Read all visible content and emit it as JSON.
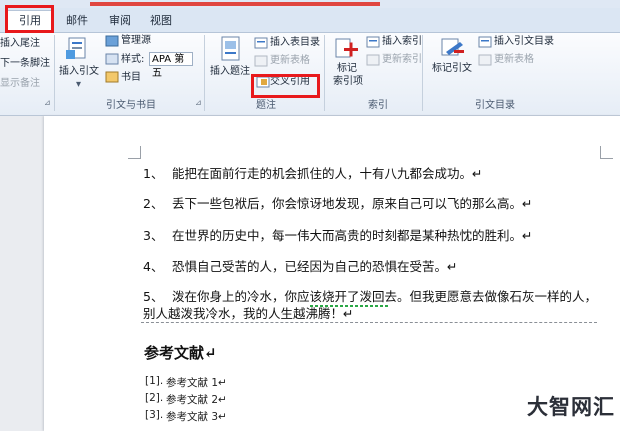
{
  "tabs": [
    {
      "label": "引用",
      "active": true
    },
    {
      "label": "邮件"
    },
    {
      "label": "审阅"
    },
    {
      "label": "视图"
    }
  ],
  "ribbon": {
    "footnote": {
      "insert_endnote": "插入尾注",
      "next_footnote": "下一条脚注",
      "show_notes": "显示备注"
    },
    "citations": {
      "insert_citation": "插入引文",
      "manage_sources": "管理源",
      "style_label": "样式:",
      "style_value": "APA 第五",
      "bibliography": "书目",
      "group_label": "引文与书目"
    },
    "captions": {
      "insert_caption": "插入题注",
      "insert_table_of_figures": "插入表目录",
      "update_table": "更新表格",
      "cross_reference": "交叉引用",
      "group_label": "题注"
    },
    "index": {
      "mark_entry_line1": "标记",
      "mark_entry_line2": "索引项",
      "insert_index": "插入索引",
      "update_index": "更新索引",
      "group_label": "索引"
    },
    "toa": {
      "mark_citation": "标记引文",
      "insert_toa": "插入引文目录",
      "update_table": "更新表格",
      "group_label": "引文目录"
    }
  },
  "document": {
    "paragraphs": [
      {
        "num": "1、",
        "text": "能把在面前行走的机会抓住的人，十有八九都会成功。↵"
      },
      {
        "num": "2、",
        "text": "丢下一些包袱后，你会惊讶地发现，原来自己可以飞的那么高。↵"
      },
      {
        "num": "3、",
        "text": "在世界的历史中，每一伟大而高贵的时刻都是某种热忱的胜利。↵"
      },
      {
        "num": "4、",
        "text": "恐惧自己受苦的人，已经因为自己的恐惧在受苦。↵"
      },
      {
        "num": "5、",
        "text": "泼在你身上的冷水，你应该烧开了泼回去。但我更愿意去做像石灰一样的人，",
        "text2": "别人越泼我冷水，我的人生越沸腾！↵"
      }
    ],
    "heading": "参考文献↵",
    "references": [
      {
        "num": "[1].",
        "text": "参考文献 1↵"
      },
      {
        "num": "[2].",
        "text": "参考文献 2↵"
      },
      {
        "num": "[3].",
        "text": "参考文献 3↵"
      }
    ]
  },
  "watermark": "大智网汇",
  "colors": {
    "highlight": "#e8191c",
    "ribbon_bg": "#e6edf6",
    "tab_bg": "#dbe6f3"
  }
}
